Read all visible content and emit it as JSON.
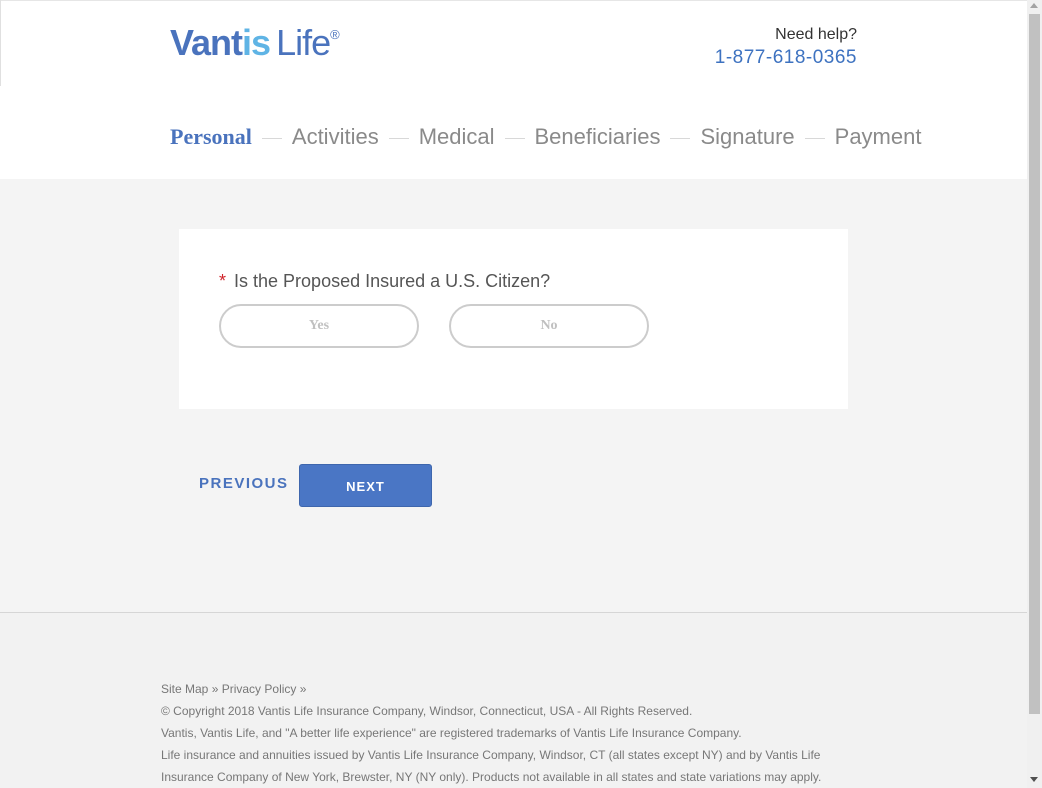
{
  "header": {
    "logo": {
      "part1": "Vant",
      "part2": "is",
      "part3": "Life",
      "reg": "®"
    },
    "help_label": "Need help?",
    "help_phone": "1-877-618-0365"
  },
  "steps": [
    {
      "label": "Personal",
      "active": true
    },
    {
      "label": "Activities",
      "active": false
    },
    {
      "label": "Medical",
      "active": false
    },
    {
      "label": "Beneficiaries",
      "active": false
    },
    {
      "label": "Signature",
      "active": false
    },
    {
      "label": "Payment",
      "active": false
    }
  ],
  "question": {
    "required_mark": "*",
    "text": "Is the Proposed Insured a U.S. Citizen?",
    "options": [
      "Yes",
      "No"
    ]
  },
  "nav": {
    "previous": "PREVIOUS",
    "next": "NEXT"
  },
  "footer": {
    "site_map": "Site Map »",
    "privacy_policy": "Privacy Policy »",
    "copyright": "© Copyright 2018 Vantis Life Insurance Company, Windsor, Connecticut, USA - All Rights Reserved.",
    "trademarks": "Vantis, Vantis Life, and \"A better life experience\" are registered trademarks of Vantis Life Insurance Company.",
    "disclaimer": "Life insurance and annuities issued by Vantis Life Insurance Company, Windsor, CT (all states except NY) and by Vantis Life Insurance Company of New York, Brewster, NY (NY only). Products not available in all states and state variations may apply."
  },
  "colors": {
    "brand_blue": "#4a73bd",
    "brand_light_blue": "#5fb4e5",
    "required_red": "#d0232a",
    "button_blue": "#4a76c5"
  }
}
